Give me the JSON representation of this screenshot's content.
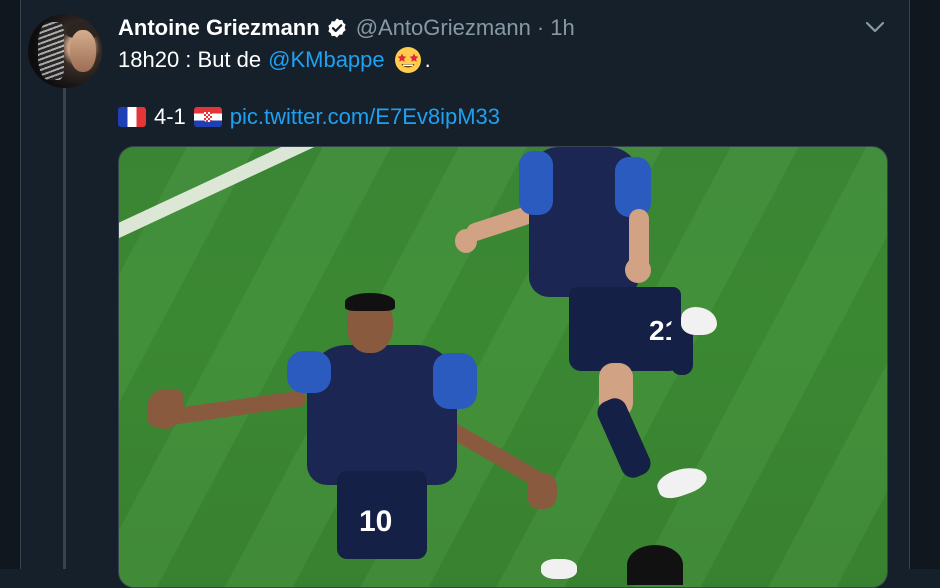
{
  "colors": {
    "background": "#15202b",
    "accent": "#1da1f2",
    "muted": "#8899a6",
    "border": "#38444d"
  },
  "tweet": {
    "author_name": "Antoine Griezmann",
    "handle": "@AntoGriezmann",
    "separator": "·",
    "time": "1h",
    "verified_icon": "verified-badge-icon",
    "menu_icon": "chevron-down-icon",
    "text_prefix": "18h20 : But de",
    "mention": "@KMbappe",
    "emoji": "star-struck-emoji",
    "text_suffix": ".",
    "flag_left": "france-flag",
    "score": "4-1",
    "flag_right": "croatia-flag",
    "link": "pic.twitter.com/E7Ev8ipM33"
  },
  "media": {
    "description_icon": "tweet-photo",
    "player_front_number": "10",
    "player_back_number": "21"
  }
}
